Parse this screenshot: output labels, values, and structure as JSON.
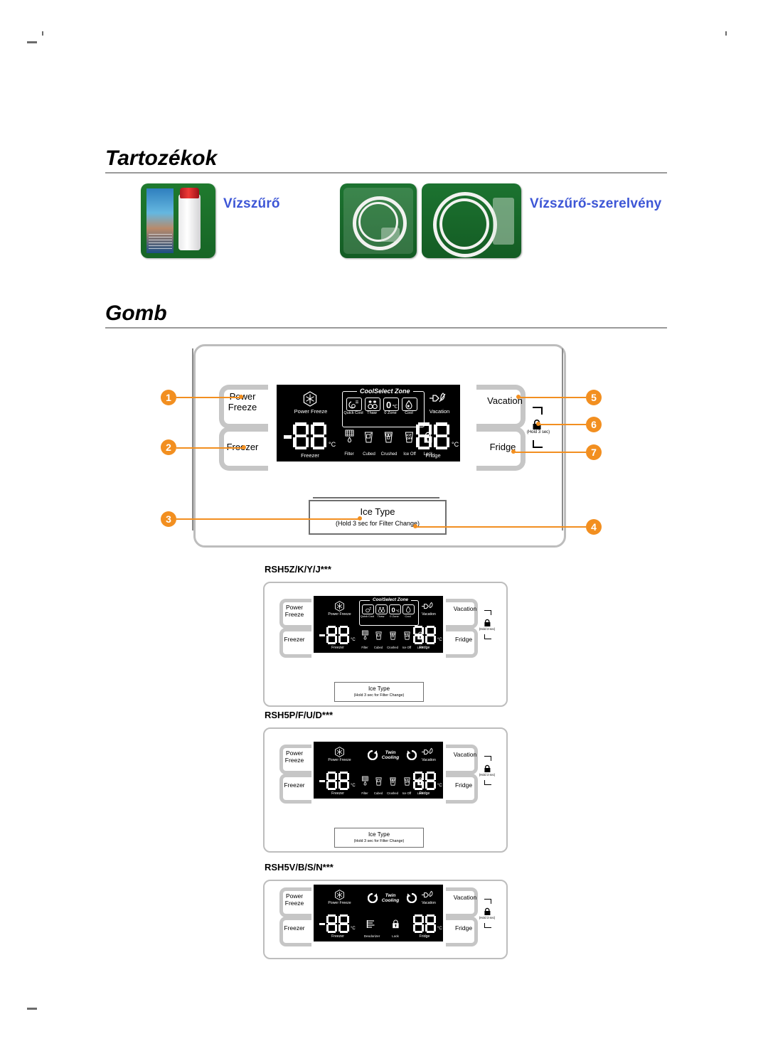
{
  "page": {
    "sections": [
      {
        "id": "tartozekok",
        "title": "Tartozékok"
      },
      {
        "id": "gomb",
        "title": "Gomb"
      }
    ]
  },
  "accessories": [
    {
      "label": "Vízszűrő",
      "image": "water-filter-box-photo"
    },
    {
      "label": "Vízszűrő-szerelvény",
      "image": "water-filter-fitting-tubes-photo"
    }
  ],
  "colors": {
    "accent_orange": "#f28f20",
    "link_blue": "#3d56d6",
    "button_gray": "#c6c6c6",
    "panel_border": "#bdbdbd",
    "lcd_background": "#000000",
    "lcd_text": "#ffffff",
    "rule_gray": "#9a9a9a"
  },
  "control_panel": {
    "buttons": {
      "power_freeze": "Power\nFreeze",
      "freezer": "Freezer",
      "vacation": "Vacation",
      "fridge": "Fridge"
    },
    "ice_type": {
      "title": "Ice Type",
      "subtitle": "(Hold 3 sec for Filter Change)"
    },
    "lock_hint": "(Hold 3 sec)",
    "display": {
      "power_freeze_label": "Power Freeze",
      "power_freeze_icon": "snowflake-icon",
      "vacation_label": "Vacation",
      "vacation_icon": "unplugged-plug-icon",
      "coolselect_zone": {
        "title": "CoolSelect Zone",
        "items": [
          {
            "label": "Quick Cool",
            "icon": "quick-cool-icon"
          },
          {
            "label": "Thaw",
            "icon": "thaw-icon"
          },
          {
            "label": "0 Zone",
            "icon": "zero-zone-icon"
          },
          {
            "label": "Cool",
            "icon": "cool-droplet-icon"
          }
        ]
      },
      "freezer_label": "Freezer",
      "freezer_value": "88",
      "freezer_minus": "-",
      "freezer_unit": "°C",
      "fridge_label": "Fridge",
      "fridge_value": "88",
      "fridge_unit": "°C",
      "status_icons": [
        {
          "label": "Filter",
          "icon": "filter-icon"
        },
        {
          "label": "Cubed",
          "icon": "cubed-ice-icon"
        },
        {
          "label": "Crushed",
          "icon": "crushed-ice-icon"
        },
        {
          "label": "Ice Off",
          "icon": "ice-off-icon"
        },
        {
          "label": "Lock",
          "icon": "padlock-icon"
        }
      ],
      "twin_cooling_label": "Twin\nCooling",
      "deodorizer_label": "Deodorizer",
      "lock_label": "Lock"
    },
    "callouts": [
      {
        "n": "1",
        "target": "power-freeze-button"
      },
      {
        "n": "2",
        "target": "freezer-button"
      },
      {
        "n": "3",
        "target": "ice-type-button"
      },
      {
        "n": "4",
        "target": "ice-type-filter-change-hint"
      },
      {
        "n": "5",
        "target": "vacation-button"
      },
      {
        "n": "6",
        "target": "lock-hold-3-sec"
      },
      {
        "n": "7",
        "target": "fridge-button"
      }
    ]
  },
  "models": [
    {
      "name": "RSH5Z/K/Y/J***",
      "variant": "coolselect"
    },
    {
      "name": "RSH5P/F/U/D***",
      "variant": "twincooling-full"
    },
    {
      "name": "RSH5V/B/S/N***",
      "variant": "twincooling-simple"
    }
  ]
}
